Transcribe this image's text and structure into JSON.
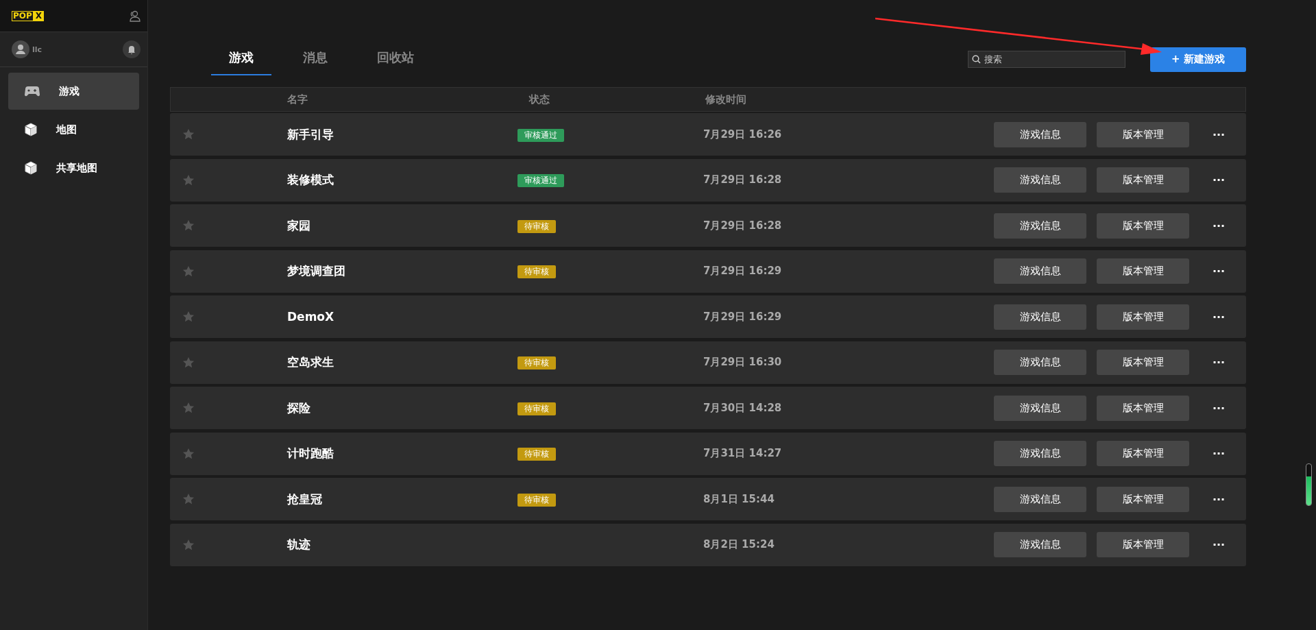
{
  "sidebar": {
    "logo": {
      "left": "POP",
      "right": "X"
    },
    "user": {
      "name": "llc"
    },
    "items": [
      {
        "label": "游戏",
        "kind": "gamepad",
        "selected": true
      },
      {
        "label": "地图",
        "kind": "cube",
        "selected": false
      },
      {
        "label": "共享地图",
        "kind": "cube",
        "selected": false
      }
    ]
  },
  "tabs": [
    {
      "label": "游戏",
      "selected": true
    },
    {
      "label": "消息",
      "selected": false
    },
    {
      "label": "回收站",
      "selected": false
    }
  ],
  "search": {
    "placeholder": "搜索"
  },
  "new_button": "+ 新建游戏",
  "table": {
    "columns": [
      "名字",
      "状态",
      "修改时间"
    ],
    "rows": [
      {
        "name": "新手引导",
        "status": "审核通过",
        "kind": "approved",
        "time": "7月29日 16:26",
        "starred": false,
        "actions": [
          "游戏信息",
          "版本管理"
        ],
        "more": "···"
      },
      {
        "name": "装修模式",
        "status": "审核通过",
        "kind": "approved",
        "time": "7月29日 16:28",
        "starred": false,
        "actions": [
          "游戏信息",
          "版本管理"
        ],
        "more": "···"
      },
      {
        "name": "家园",
        "status": "待审核",
        "kind": "pending",
        "time": "7月29日 16:28",
        "starred": false,
        "actions": [
          "游戏信息",
          "版本管理"
        ],
        "more": "···"
      },
      {
        "name": "梦境调查团",
        "status": "待审核",
        "kind": "pending",
        "time": "7月29日 16:29",
        "starred": false,
        "actions": [
          "游戏信息",
          "版本管理"
        ],
        "more": "···"
      },
      {
        "name": "DemoX",
        "time": "7月29日 16:29",
        "starred": false,
        "actions": [
          "游戏信息",
          "版本管理"
        ],
        "more": "···"
      },
      {
        "name": "空岛求生",
        "status": "待审核",
        "kind": "pending",
        "time": "7月29日 16:30",
        "starred": false,
        "actions": [
          "游戏信息",
          "版本管理"
        ],
        "more": "···"
      },
      {
        "name": "探险",
        "status": "待审核",
        "kind": "pending",
        "time": "7月30日 14:28",
        "starred": false,
        "actions": [
          "游戏信息",
          "版本管理"
        ],
        "more": "···"
      },
      {
        "name": "计时跑酷",
        "status": "待审核",
        "kind": "pending",
        "time": "7月31日 14:27",
        "starred": false,
        "actions": [
          "游戏信息",
          "版本管理"
        ],
        "more": "···"
      },
      {
        "name": "抢皇冠",
        "status": "待审核",
        "kind": "pending",
        "time": "8月1日 15:44",
        "starred": false,
        "actions": [
          "游戏信息",
          "版本管理"
        ],
        "more": "···"
      },
      {
        "name": "轨迹",
        "time": "8月2日 15:24",
        "starred": false,
        "actions": [
          "游戏信息",
          "版本管理"
        ],
        "more": "···"
      }
    ]
  },
  "meter": {
    "level": 0.7
  }
}
